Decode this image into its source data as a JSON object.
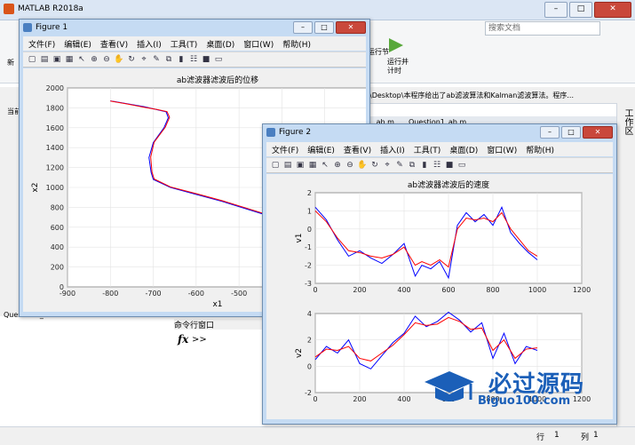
{
  "matlab": {
    "title": "MATLAB R2018a",
    "search_placeholder": "搜索文档",
    "addr_text": "\\Desktop\\本程序给出了ab滤波算法和Kalman滤波算法。程序...",
    "tab_file_1": "...ab.m",
    "tab_file_2": "Question1_ab.m",
    "run_section_label": "运行节",
    "run_time_label": "运行并\n计时",
    "cmd_title": "命令行窗口",
    "cmd_prompt": ">>",
    "fx": "fx",
    "left_workspace": "Question1_ab...",
    "status_row_label": "行",
    "status_row": "1",
    "status_col_label": "列",
    "status_col": "1",
    "right_panel": "工作区",
    "left_tab_1": "新",
    "left_tab_2": "当前"
  },
  "menus": [
    "文件(F)",
    "编辑(E)",
    "查看(V)",
    "插入(I)",
    "工具(T)",
    "桌面(D)",
    "窗口(W)",
    "帮助(H)"
  ],
  "figure1": {
    "title": "Figure 1",
    "chart_title": "ab滤波器滤波后的位移",
    "xlabel": "x1",
    "ylabel": "x2"
  },
  "figure2": {
    "title": "Figure 2",
    "chart1_title": "ab滤波器滤波后的速度",
    "ylabel1": "v1",
    "ylabel2": "v2"
  },
  "watermark": {
    "brand": "必过源码",
    "url": "Biguo100.com"
  },
  "chart_data": [
    {
      "type": "line",
      "title": "ab滤波器滤波后的位移",
      "xlabel": "x1",
      "ylabel": "x2",
      "xlim": [
        -900,
        -200
      ],
      "ylim": [
        0,
        2000
      ],
      "xticks": [
        -900,
        -800,
        -700,
        -600,
        -500,
        -400,
        -300,
        -200
      ],
      "yticks": [
        0,
        200,
        400,
        600,
        800,
        1000,
        1200,
        1400,
        1600,
        1800,
        2000
      ],
      "grid": true,
      "series": [
        {
          "color": "#0000ff",
          "x": [
            -800,
            -760,
            -720,
            -690,
            -670,
            -665,
            -675,
            -700,
            -710,
            -705,
            -700,
            -660,
            -600,
            -540,
            -480,
            -420,
            -370,
            -320,
            -280,
            -250,
            -220,
            -200,
            -190
          ],
          "y": [
            1870,
            1840,
            1810,
            1780,
            1760,
            1700,
            1600,
            1450,
            1300,
            1150,
            1080,
            1000,
            930,
            860,
            780,
            700,
            610,
            490,
            360,
            260,
            220,
            205,
            200
          ]
        },
        {
          "color": "#ff0000",
          "x": [
            -800,
            -760,
            -720,
            -690,
            -668,
            -662,
            -672,
            -698,
            -706,
            -703,
            -698,
            -660,
            -598,
            -538,
            -478,
            -418,
            -368,
            -318,
            -278,
            -248,
            -218,
            -198,
            -188
          ],
          "y": [
            1868,
            1838,
            1805,
            1782,
            1762,
            1705,
            1605,
            1455,
            1305,
            1155,
            1085,
            1005,
            935,
            865,
            785,
            705,
            612,
            495,
            365,
            262,
            222,
            207,
            202
          ]
        }
      ]
    },
    {
      "type": "line",
      "title": "ab滤波器滤波后的速度",
      "xlabel": "",
      "ylabel": "v1",
      "xlim": [
        0,
        1200
      ],
      "ylim": [
        -3,
        2
      ],
      "xticks": [
        0,
        200,
        400,
        600,
        800,
        1000,
        1200
      ],
      "yticks": [
        -3,
        -2,
        -1,
        0,
        1,
        2
      ],
      "grid": true,
      "series": [
        {
          "color": "#0000ff",
          "x": [
            0,
            50,
            100,
            150,
            200,
            250,
            300,
            350,
            400,
            450,
            480,
            520,
            560,
            600,
            640,
            680,
            720,
            760,
            800,
            840,
            880,
            920,
            960,
            1000
          ],
          "y": [
            1.2,
            0.5,
            -0.6,
            -1.5,
            -1.2,
            -1.6,
            -1.9,
            -1.4,
            -0.8,
            -2.6,
            -2.0,
            -2.2,
            -1.8,
            -2.7,
            0.2,
            0.9,
            0.4,
            0.8,
            0.2,
            1.2,
            -0.2,
            -0.8,
            -1.3,
            -1.7
          ]
        },
        {
          "color": "#ff0000",
          "x": [
            0,
            50,
            100,
            150,
            200,
            250,
            300,
            350,
            400,
            450,
            480,
            520,
            560,
            600,
            640,
            680,
            720,
            760,
            800,
            840,
            880,
            920,
            960,
            1000
          ],
          "y": [
            1.0,
            0.4,
            -0.5,
            -1.2,
            -1.3,
            -1.5,
            -1.6,
            -1.4,
            -1.0,
            -2.0,
            -1.8,
            -2.0,
            -1.7,
            -2.1,
            0.0,
            0.6,
            0.5,
            0.6,
            0.4,
            0.9,
            0.0,
            -0.6,
            -1.2,
            -1.5
          ]
        }
      ]
    },
    {
      "type": "line",
      "title": "",
      "xlabel": "",
      "ylabel": "v2",
      "xlim": [
        0,
        1200
      ],
      "ylim": [
        -2,
        4
      ],
      "xticks": [
        0,
        200,
        400,
        600,
        800,
        1000,
        1200
      ],
      "yticks": [
        -2,
        0,
        2,
        4
      ],
      "grid": true,
      "series": [
        {
          "color": "#0000ff",
          "x": [
            0,
            50,
            100,
            150,
            200,
            250,
            300,
            350,
            400,
            450,
            500,
            550,
            600,
            650,
            700,
            750,
            800,
            850,
            900,
            950,
            1000
          ],
          "y": [
            0.5,
            1.5,
            1.0,
            2.0,
            0.2,
            -0.2,
            0.8,
            1.8,
            2.5,
            3.8,
            3.0,
            3.4,
            4.1,
            3.5,
            2.6,
            3.3,
            0.6,
            2.5,
            0.2,
            1.5,
            1.2
          ]
        },
        {
          "color": "#ff0000",
          "x": [
            0,
            50,
            100,
            150,
            200,
            250,
            300,
            350,
            400,
            450,
            500,
            550,
            600,
            650,
            700,
            750,
            800,
            850,
            900,
            950,
            1000
          ],
          "y": [
            0.7,
            1.3,
            1.2,
            1.5,
            0.6,
            0.4,
            1.0,
            1.6,
            2.4,
            3.3,
            3.1,
            3.2,
            3.7,
            3.4,
            2.8,
            2.9,
            1.2,
            2.0,
            0.6,
            1.3,
            1.4
          ]
        }
      ]
    }
  ]
}
